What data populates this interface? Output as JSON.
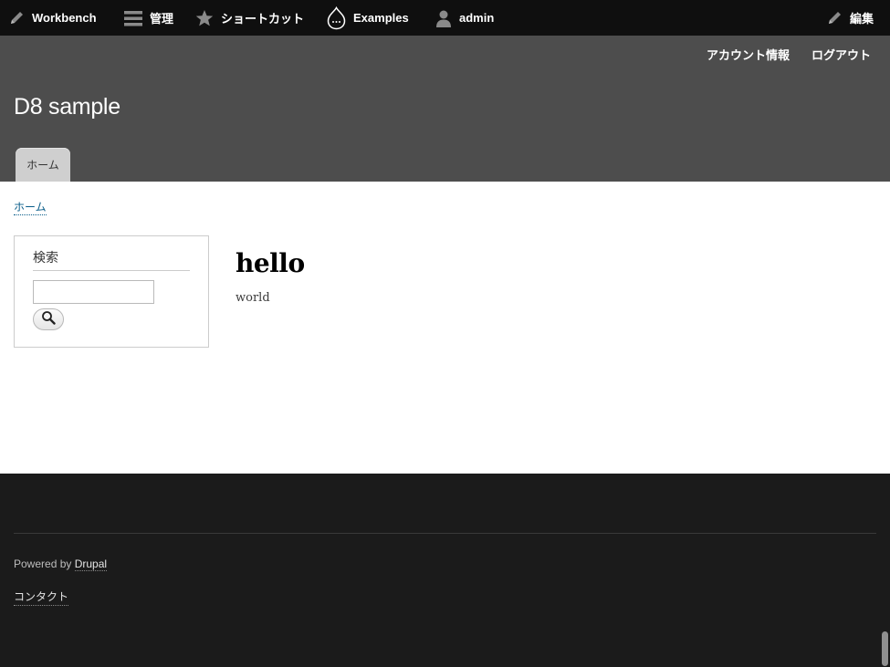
{
  "toolbar": {
    "workbench": {
      "label": "Workbench",
      "icon": "pencil-icon"
    },
    "manage": {
      "label": "管理",
      "icon": "menu-icon"
    },
    "shortcuts": {
      "label": "ショートカット",
      "icon": "star-icon"
    },
    "examples": {
      "label": "Examples",
      "icon": "drupal-drop-icon"
    },
    "user": {
      "label": "admin",
      "icon": "user-icon"
    },
    "edit": {
      "label": "編集",
      "icon": "pencil-icon"
    }
  },
  "header": {
    "secondary_menu": [
      "アカウント情報",
      "ログアウト"
    ],
    "site_name": "D8 sample",
    "tabs": [
      "ホーム"
    ]
  },
  "breadcrumb": [
    "ホーム"
  ],
  "search": {
    "title": "検索",
    "value": "",
    "button_icon": "search-icon"
  },
  "node": {
    "title": "hello",
    "body": "world"
  },
  "footer": {
    "powered_by": "Powered by",
    "drupal_link": "Drupal",
    "contact_link": "コンタクト"
  },
  "colors": {
    "toolbar_bg": "#0f0f0f",
    "header_bg": "#4d4d4d",
    "footer_bg": "#1b1b1b",
    "link": "#0a5d8a"
  }
}
